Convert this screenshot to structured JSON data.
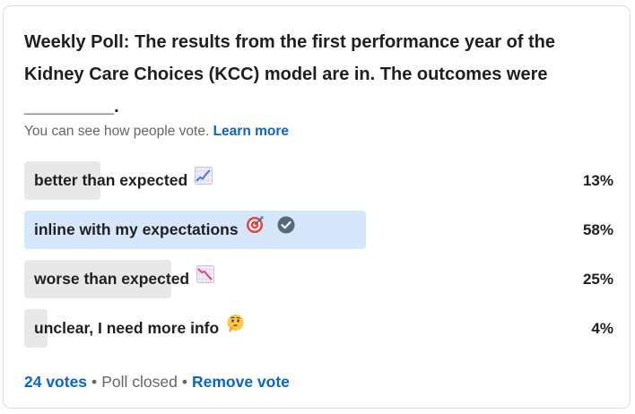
{
  "poll": {
    "question": "Weekly Poll: The results from the first performance year of the Kidney Care Choices (KCC) model are in. The outcomes were\n_________.",
    "visibility_text": "You can see how people vote.",
    "learn_more": "Learn more",
    "options": [
      {
        "label": "better than expected",
        "percent_label": "13%",
        "percent": 13,
        "icon": "chart-increasing-emoji",
        "selected": false
      },
      {
        "label": "inline with my expectations",
        "percent_label": "58%",
        "percent": 58,
        "icon": "direct-hit-emoji",
        "selected": true
      },
      {
        "label": "worse than expected",
        "percent_label": "25%",
        "percent": 25,
        "icon": "chart-decreasing-emoji",
        "selected": false
      },
      {
        "label": "unclear, I need more info",
        "percent_label": "4%",
        "percent": 4,
        "icon": "thinking-face-emoji",
        "selected": false
      }
    ],
    "footer": {
      "votes": "24 votes",
      "status": "Poll closed",
      "remove_vote": "Remove vote",
      "separator": "•"
    },
    "colors": {
      "link": "#0a66c2",
      "bar": "#e8e8e8",
      "bar_selected": "#d6e7fb",
      "check": "#56687a"
    }
  }
}
